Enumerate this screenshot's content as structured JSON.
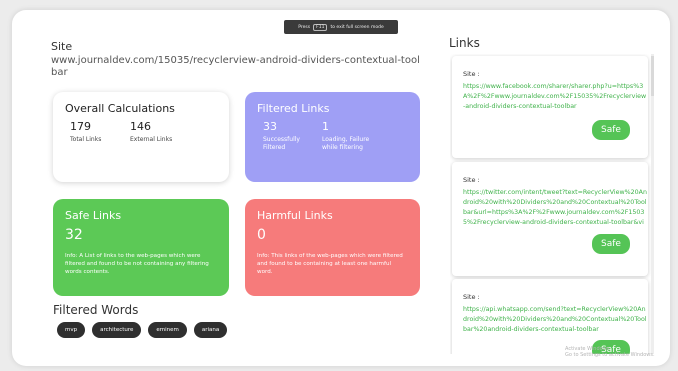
{
  "fullscreen_notice": {
    "prefix": "Press",
    "key": "F11",
    "suffix": "to exit full screen mode"
  },
  "site": {
    "label": "Site",
    "url": "www.journaldev.com/15035/recyclerview-android-dividers-contextual-toolbar"
  },
  "overall": {
    "title": "Overall Calculations",
    "total_links_value": "179",
    "total_links_label": "Total Links",
    "external_links_value": "146",
    "external_links_label": "External Links"
  },
  "filtered": {
    "title": "Filtered Links",
    "success_value": "33",
    "success_label": "Successfully Filtered",
    "loading_value": "1",
    "loading_label": "Loading, Failure while filtering"
  },
  "safe": {
    "title": "Safe Links",
    "value": "32",
    "info": "Info: A List of links to the web-pages which were filtered and found to be not containing any filtering words contents."
  },
  "harmful": {
    "title": "Harmful Links",
    "value": "0",
    "info": "Info: This links of the web-pages which were filtered and found to be containing at least one harmful word."
  },
  "filtered_words": {
    "title": "Filtered Words",
    "chips": [
      "mvp",
      "architecture",
      "eminem",
      "ariana"
    ]
  },
  "links": {
    "title": "Links",
    "items": [
      {
        "site_label": "Site :",
        "url": "https://www.facebook.com/sharer/sharer.php?u=https%3A%2F%2Fwww.journaldev.com%2F15035%2Frecyclerview-android-dividers-contextual-toolbar",
        "status": "Safe"
      },
      {
        "site_label": "Site :",
        "url": "https://twitter.com/intent/tweet?text=RecyclerView%20Android%20with%20Dividers%20and%20Contextual%20Toolbar&url=https%3A%2F%2Fwww.journaldev.com%2F15035%2Frecyclerview-android-dividers-contextual-toolbar&via=JournalDev&related=JournalDev",
        "status": "Safe"
      },
      {
        "site_label": "Site :",
        "url": "https://api.whatsapp.com/send?text=RecyclerView%20Android%20with%20Dividers%20and%20Contextual%20Toolbar%20android-dividers-contextual-toolbar",
        "status": "Safe"
      }
    ]
  },
  "watermark": {
    "line1": "Activate Windows",
    "line2": "Go to Settings to activate Windows."
  },
  "colors": {
    "purple_card": "#9f9ff5",
    "green_card": "#5cc956",
    "red_card": "#f67b7b",
    "link_green": "#3fb24a",
    "chip_bg": "#2f2f2f"
  }
}
